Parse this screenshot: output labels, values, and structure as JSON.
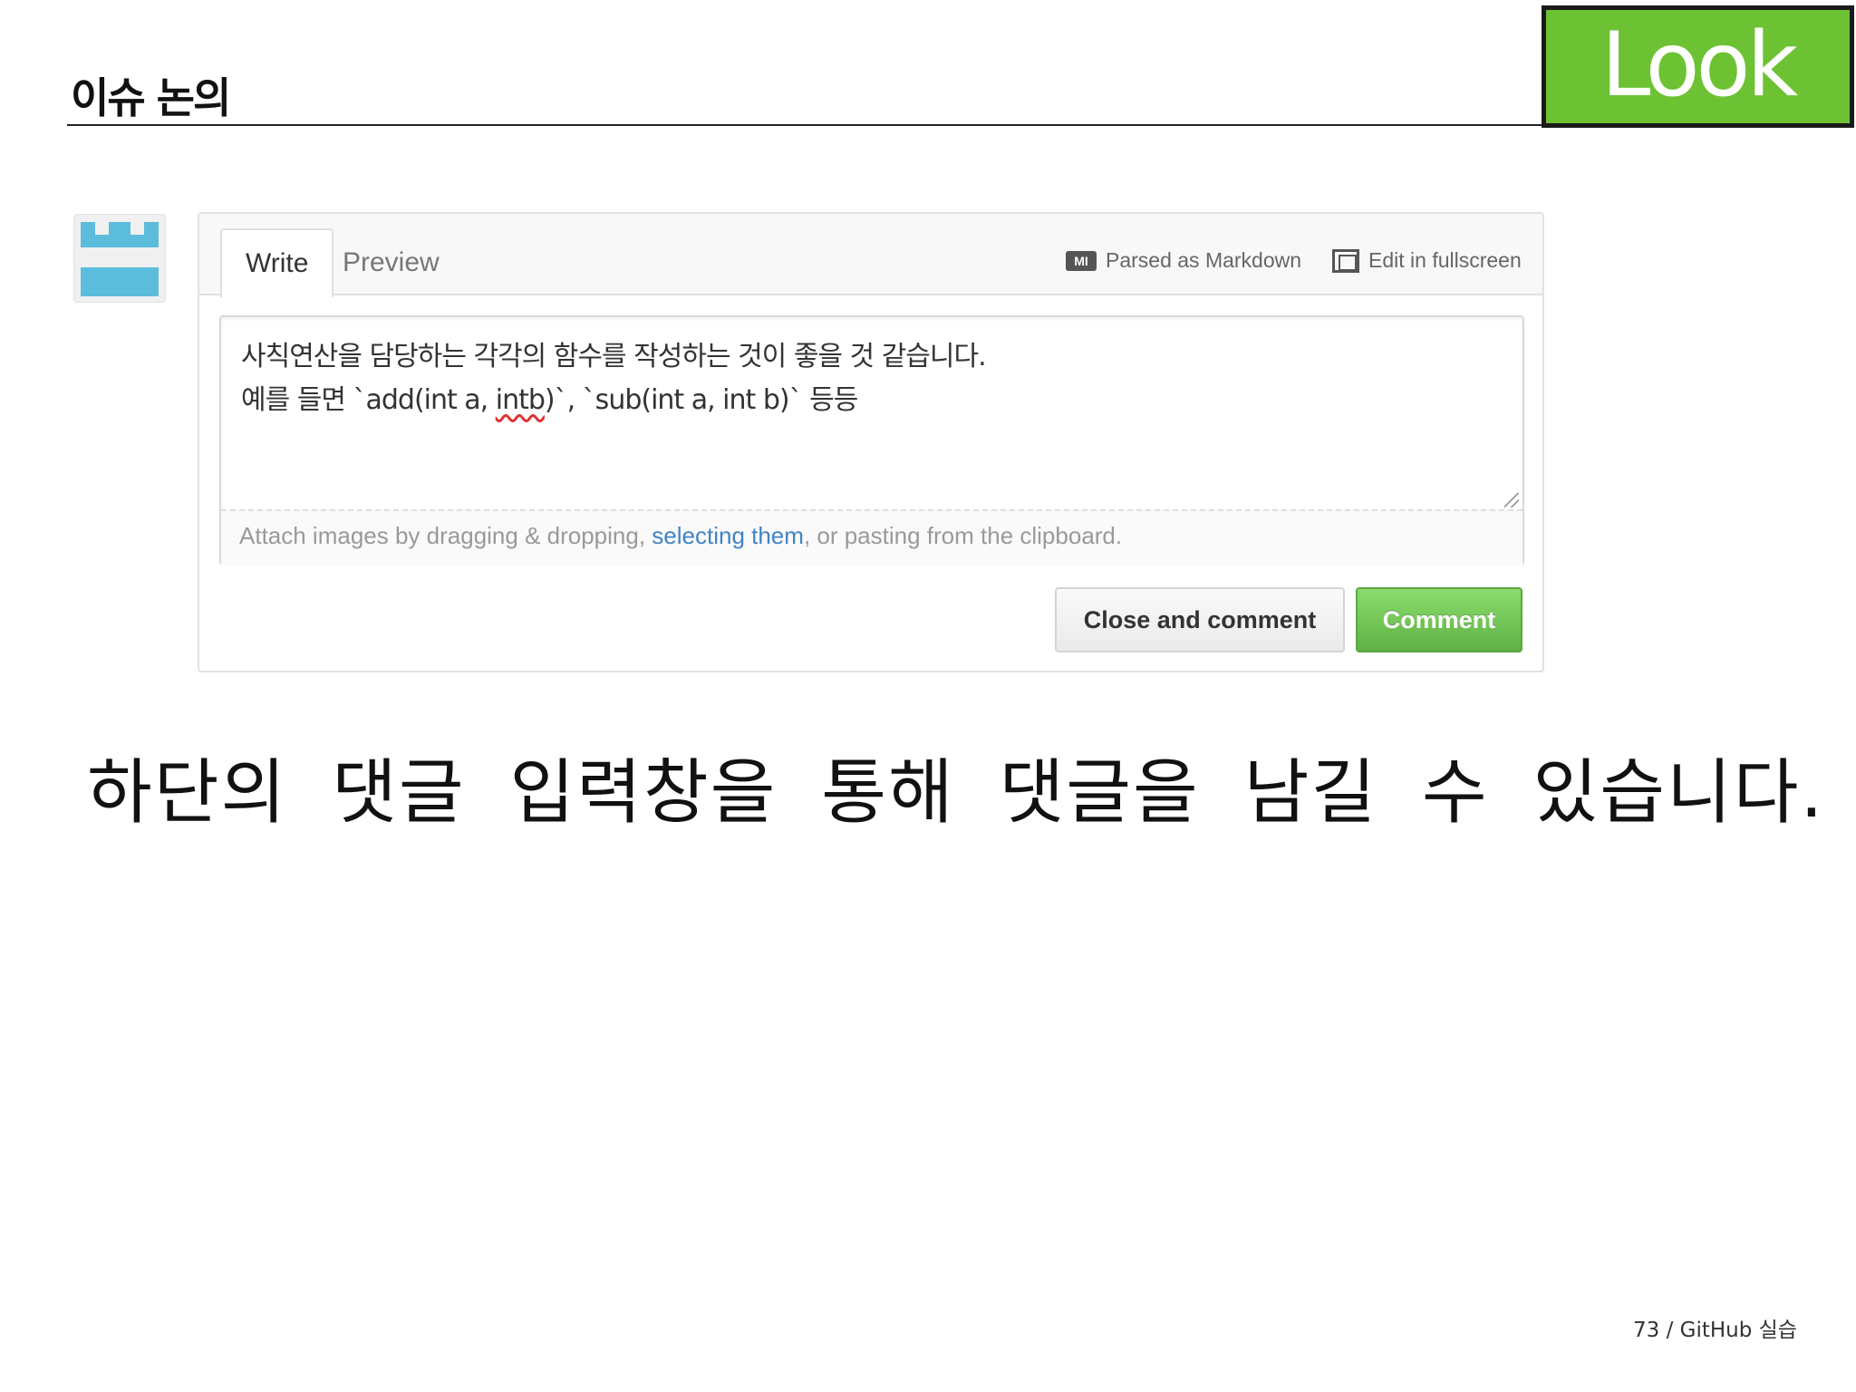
{
  "slide": {
    "title": "이슈 논의",
    "badge": "Look",
    "caption": "하단의 댓글 입력창을 통해 댓글을 남길 수 있습니다.",
    "footer": "73 / GitHub 실습"
  },
  "colors": {
    "badge_green": "#6cc233",
    "comment_button_green": "#6cc033",
    "link_blue": "#4183c4",
    "avatar_blue": "#5bbcdc"
  },
  "comment_form": {
    "tabs": [
      {
        "label": "Write",
        "selected": true
      },
      {
        "label": "Preview",
        "selected": false
      }
    ],
    "markdown_icon": "MI",
    "parsed_as_markdown": "Parsed as Markdown",
    "edit_fullscreen": "Edit in fullscreen",
    "text_line1": "사칙연산을 담당하는 각각의 함수를 작성하는 것이 좋을 것 같습니다.",
    "text_line2_pre": "예를 들면 `add(int a, ",
    "text_line2_misspelled": "intb",
    "text_line2_post": ")`, `sub(int a, int b)` 등등",
    "attach_pre": "Attach images by dragging & dropping, ",
    "attach_link": "selecting them",
    "attach_post": ", or pasting from the clipboard.",
    "close_button": "Close and comment",
    "comment_button": "Comment"
  }
}
